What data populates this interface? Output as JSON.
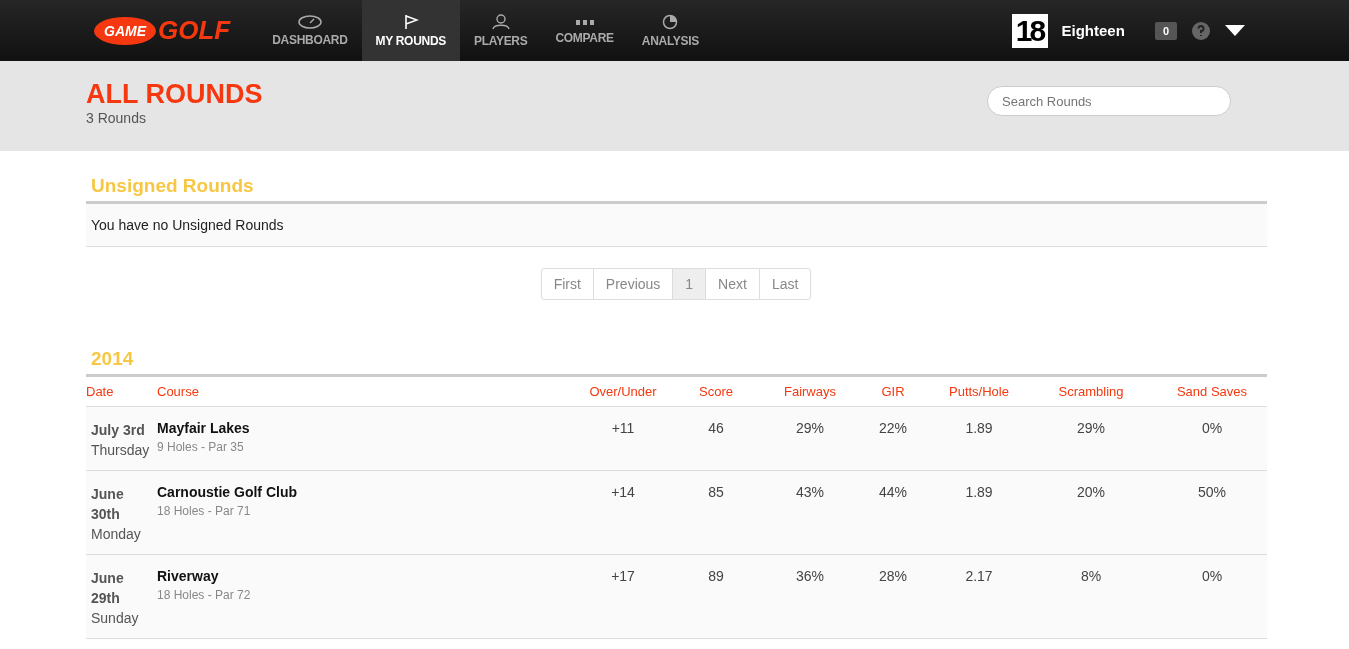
{
  "brand": {
    "badge": "GAME",
    "word": "GOLF"
  },
  "nav": [
    {
      "label": "DASHBOARD",
      "selected": false
    },
    {
      "label": "MY ROUNDS",
      "selected": true
    },
    {
      "label": "PLAYERS",
      "selected": false
    },
    {
      "label": "COMPARE",
      "selected": false
    },
    {
      "label": "ANALYSIS",
      "selected": false
    }
  ],
  "user": {
    "avatar": "18",
    "name": "Eighteen",
    "messages": "0"
  },
  "page": {
    "title": "ALL ROUNDS",
    "subtitle": "3 Rounds",
    "search_placeholder": "Search Rounds"
  },
  "unsigned": {
    "title": "Unsigned Rounds",
    "message": "You have no Unsigned Rounds"
  },
  "pagination": [
    {
      "label": "First",
      "selected": false
    },
    {
      "label": "Previous",
      "selected": false
    },
    {
      "label": "1",
      "selected": true
    },
    {
      "label": "Next",
      "selected": false
    },
    {
      "label": "Last",
      "selected": false
    }
  ],
  "year": "2014",
  "table": {
    "columns": [
      "Date",
      "Course",
      "Over/Under",
      "Score",
      "Fairways",
      "GIR",
      "Putts/Hole",
      "Scrambling",
      "Sand Saves"
    ],
    "rows": [
      {
        "date": "July 3rd",
        "weekday": "Thursday",
        "course": "Mayfair Lakes",
        "holes": "9 Holes - Par 35",
        "stats": [
          "+11",
          "46",
          "29%",
          "22%",
          "1.89",
          "29%",
          "0%"
        ]
      },
      {
        "date": "June 30th",
        "weekday": "Monday",
        "course": "Carnoustie Golf Club",
        "holes": "18 Holes - Par 71",
        "stats": [
          "+14",
          "85",
          "43%",
          "44%",
          "1.89",
          "20%",
          "50%"
        ]
      },
      {
        "date": "June 29th",
        "weekday": "Sunday",
        "course": "Riverway",
        "holes": "18 Holes - Par 72",
        "stats": [
          "+17",
          "89",
          "36%",
          "28%",
          "2.17",
          "8%",
          "0%"
        ]
      }
    ]
  }
}
